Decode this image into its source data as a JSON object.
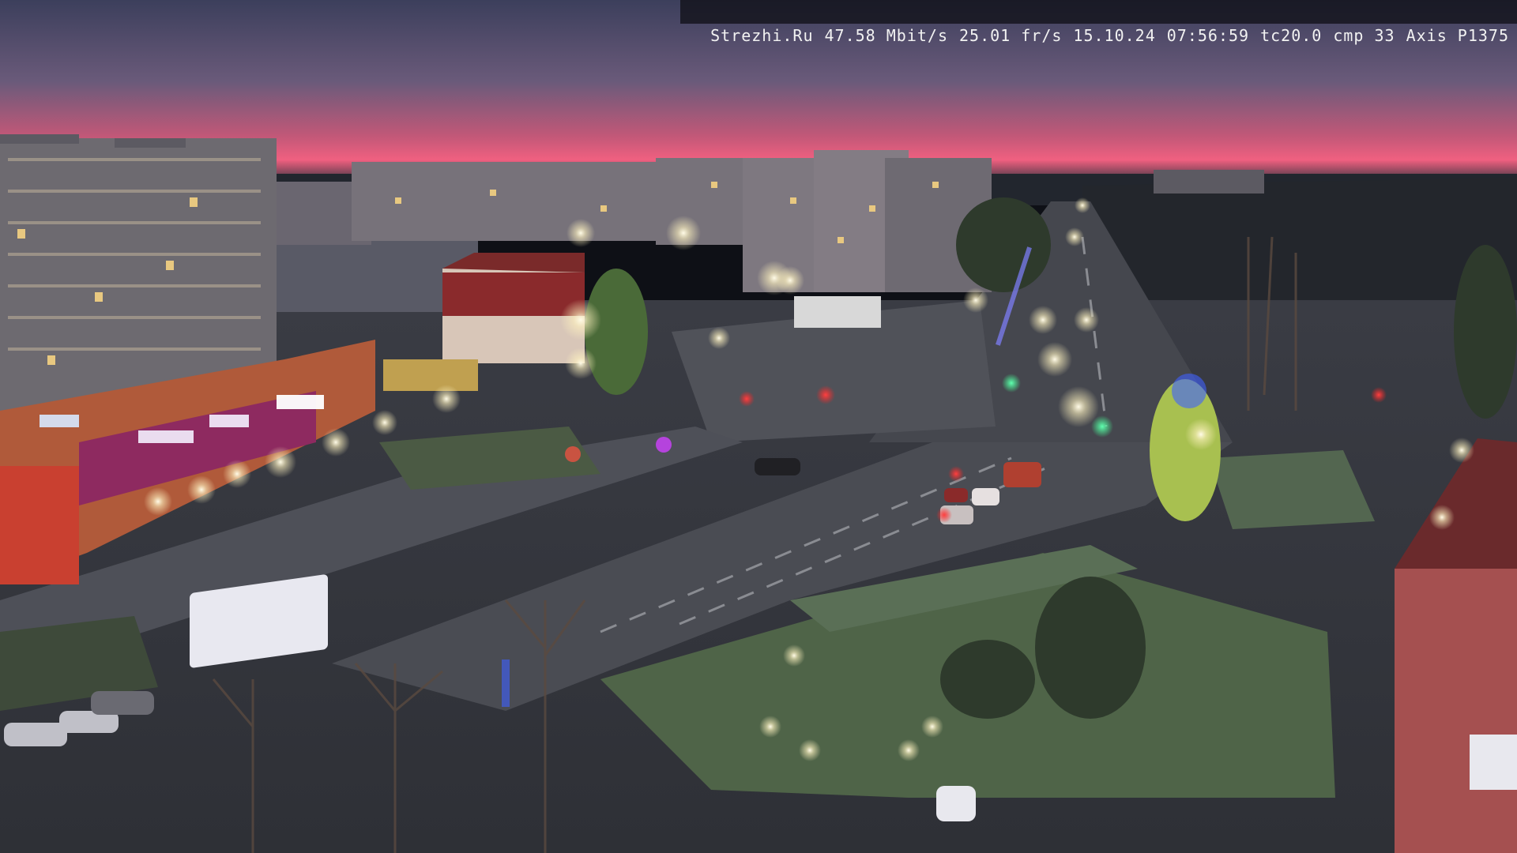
{
  "overlay": {
    "site": "Strezhi.Ru",
    "bitrate": "47.58 Mbit/s",
    "framerate": "25.01 fr/s",
    "date": "15.10.24",
    "time": "07:56:59",
    "tc": "tc20.0",
    "cmp": "cmp 33",
    "camera": "Axis P1375"
  },
  "scene": {
    "description_colors": {
      "sky_top": "#4a4c68",
      "sky_glow": "#e0587a",
      "horizon": "#2a2c38",
      "road": "#4a4c52",
      "grass": "#56704e",
      "lamp": "#fff6d8"
    }
  }
}
